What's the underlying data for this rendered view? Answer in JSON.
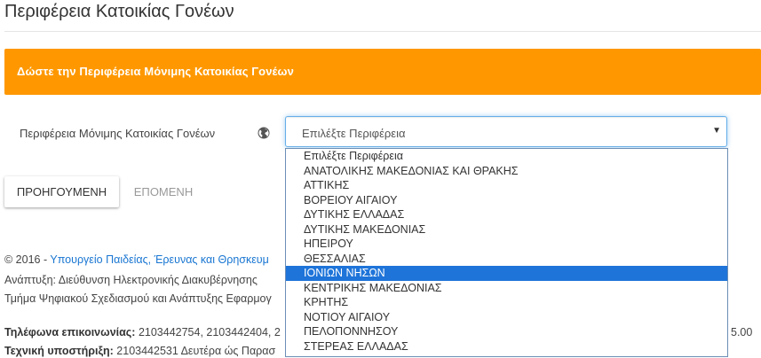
{
  "page": {
    "title": "Περιφέρεια Κατοικίας Γονέων"
  },
  "banner": {
    "text": "Δώστε την Περιφέρεια Μόνιμης Κατοικίας Γονέων",
    "color": "#ff9800"
  },
  "field": {
    "label": "Περιφέρεια Μόνιμης Κατοικίας Γονέων",
    "icon": "globe-icon",
    "selected_value": "Επιλέξτε Περιφέρεια",
    "options": [
      "Επιλέξτε Περιφέρεια",
      "ΑΝΑΤΟΛΙΚΗΣ ΜΑΚΕΔΟΝΙΑΣ ΚΑΙ ΘΡΑΚΗΣ",
      "ΑΤΤΙΚΗΣ",
      "ΒΟΡΕΙΟΥ ΑΙΓΑΙΟΥ",
      "ΔΥΤΙΚΗΣ ΕΛΛΑΔΑΣ",
      "ΔΥΤΙΚΗΣ ΜΑΚΕΔΟΝΙΑΣ",
      "ΗΠΕΙΡΟΥ",
      "ΘΕΣΣΑΛΙΑΣ",
      "ΙΟΝΙΩΝ ΝΗΣΩΝ",
      "ΚΕΝΤΡΙΚΗΣ ΜΑΚΕΔΟΝΙΑΣ",
      "ΚΡΗΤΗΣ",
      "ΝΟΤΙΟΥ ΑΙΓΑΙΟΥ",
      "ΠΕΛΟΠΟΝΝΗΣΟΥ",
      "ΣΤΕΡΕΑΣ ΕΛΛΑΔΑΣ"
    ],
    "highlighted_option": "ΙΟΝΙΩΝ ΝΗΣΩΝ",
    "highlight_color": "#1e74d9"
  },
  "buttons": {
    "previous": "ΠΡΟΗΓΟΥΜΕΝΗ",
    "next": "ΕΠΟΜΕΝΗ"
  },
  "footer": {
    "copyright_prefix": "© 2016 - ",
    "ministry_link": "Υπουργείο Παιδείας, Έρευνας και Θρησκευμ",
    "development": "Ανάπτυξη: Διεύθυνση Ηλεκτρονικής Διακυβέρνησης",
    "department": "Τμήμα Ψηφιακού Σχεδιασμού και Ανάπτυξης Εφαρμογ",
    "phone_label": "Τηλέφωνα επικοινωνίας:",
    "phone_value": " 2103442754, 2103442404, 2",
    "phone_tail": "5.00",
    "support_label": "Τεχνική υποστήριξη:",
    "support_value": " 2103442531 Δευτέρα ώς Παρασ"
  }
}
